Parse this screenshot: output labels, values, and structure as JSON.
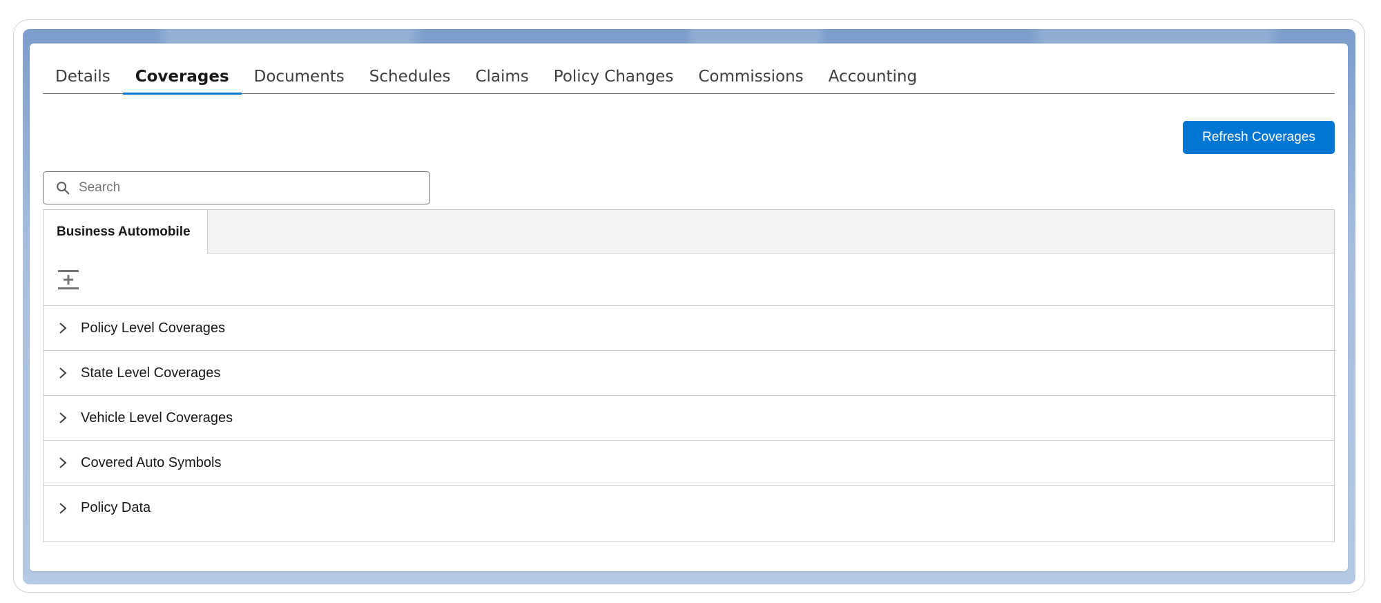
{
  "tabs": [
    {
      "label": "Details",
      "active": false
    },
    {
      "label": "Coverages",
      "active": true
    },
    {
      "label": "Documents",
      "active": false
    },
    {
      "label": "Schedules",
      "active": false
    },
    {
      "label": "Claims",
      "active": false
    },
    {
      "label": "Policy Changes",
      "active": false
    },
    {
      "label": "Commissions",
      "active": false
    },
    {
      "label": "Accounting",
      "active": false
    }
  ],
  "toolbar": {
    "refresh_label": "Refresh Coverages"
  },
  "search": {
    "placeholder": "Search",
    "value": ""
  },
  "coverage_panel": {
    "tab_label": "Business Automobile",
    "sections": [
      {
        "label": "Policy Level Coverages"
      },
      {
        "label": "State Level Coverages"
      },
      {
        "label": "Vehicle Level Coverages"
      },
      {
        "label": "Covered Auto Symbols"
      },
      {
        "label": "Policy Data"
      }
    ]
  },
  "colors": {
    "brand_blue": "#0176d3",
    "border_gray": "#c9c9c9",
    "tab_bar_gray": "#f3f3f3"
  },
  "icons": {
    "search": "search-icon",
    "expand_all": "expand-all-icon",
    "chevron": "chevron-right-icon"
  }
}
